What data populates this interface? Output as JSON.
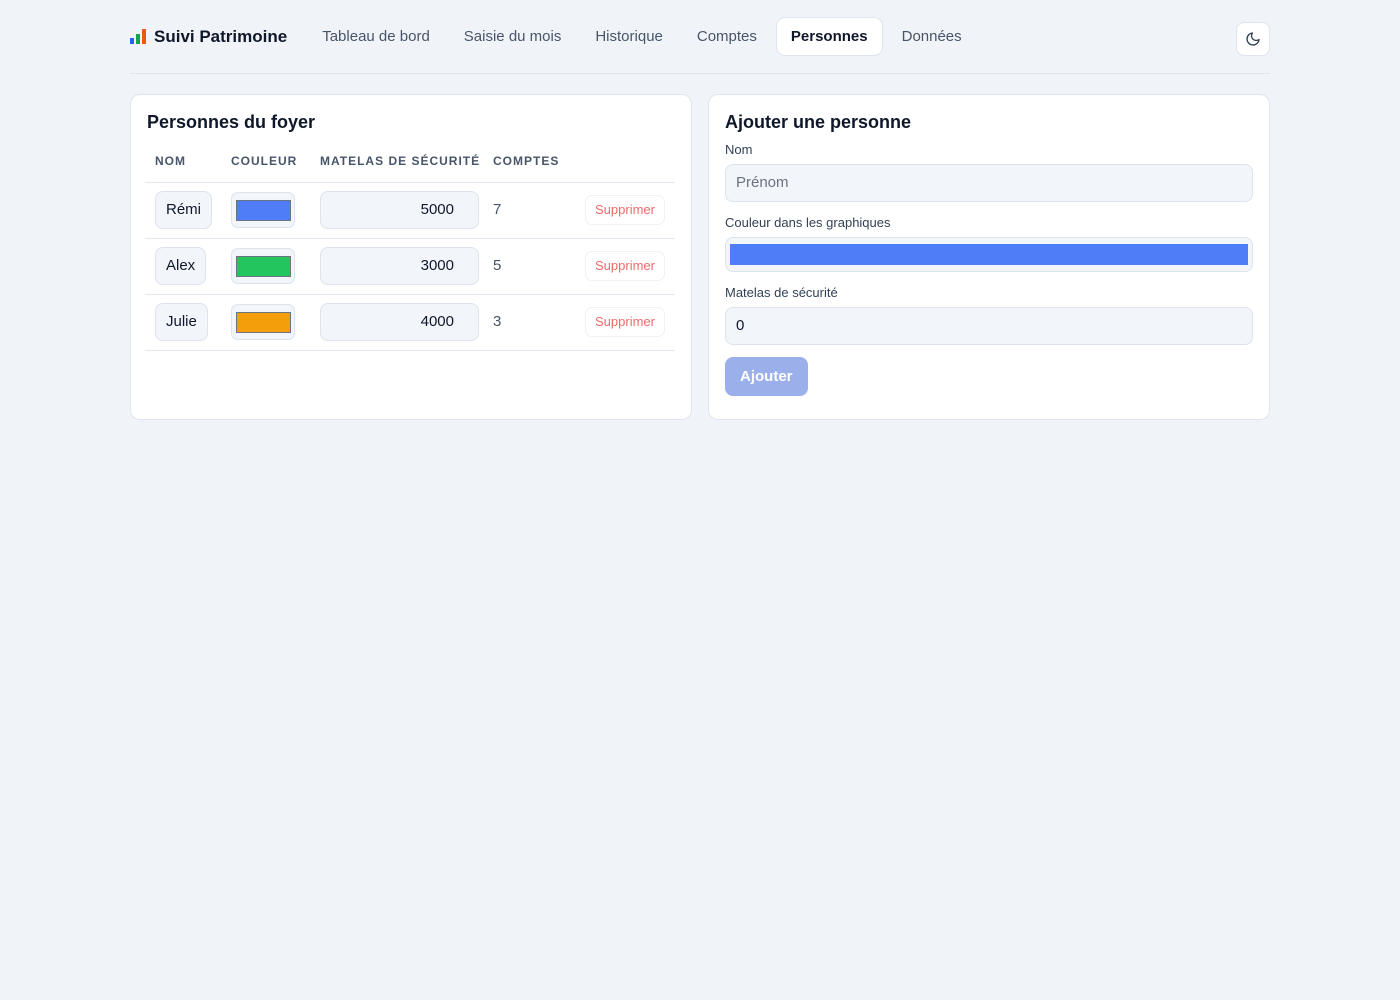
{
  "header": {
    "title": "Suivi Patrimoine",
    "brand_colors": [
      "#2563eb",
      "#16a34a",
      "#ea580c"
    ],
    "tabs": [
      {
        "label": "Tableau de bord",
        "active": false
      },
      {
        "label": "Saisie du mois",
        "active": false
      },
      {
        "label": "Historique",
        "active": false
      },
      {
        "label": "Comptes",
        "active": false
      },
      {
        "label": "Personnes",
        "active": true
      },
      {
        "label": "Données",
        "active": false
      }
    ],
    "theme_icon": "moon-icon"
  },
  "persons": {
    "title": "Personnes du foyer",
    "columns": [
      "NOM",
      "COULEUR",
      "MATELAS DE SÉCURITÉ",
      "COMPTES"
    ],
    "rows": [
      {
        "name": "Rémi",
        "color": "#4f7cf7",
        "matelas": "5000",
        "comptes": "7",
        "delete": "Supprimer"
      },
      {
        "name": "Alex",
        "color": "#22c55e",
        "matelas": "3000",
        "comptes": "5",
        "delete": "Supprimer"
      },
      {
        "name": "Julie",
        "color": "#f59e0b",
        "matelas": "4000",
        "comptes": "3",
        "delete": "Supprimer"
      }
    ]
  },
  "add_form": {
    "title": "Ajouter une personne",
    "name_label": "Nom",
    "name_placeholder": "Prénom",
    "color_label": "Couleur dans les graphiques",
    "color_value": "#4f7cf7",
    "matelas_label": "Matelas de sécurité",
    "matelas_value": "0",
    "submit_label": "Ajouter"
  }
}
